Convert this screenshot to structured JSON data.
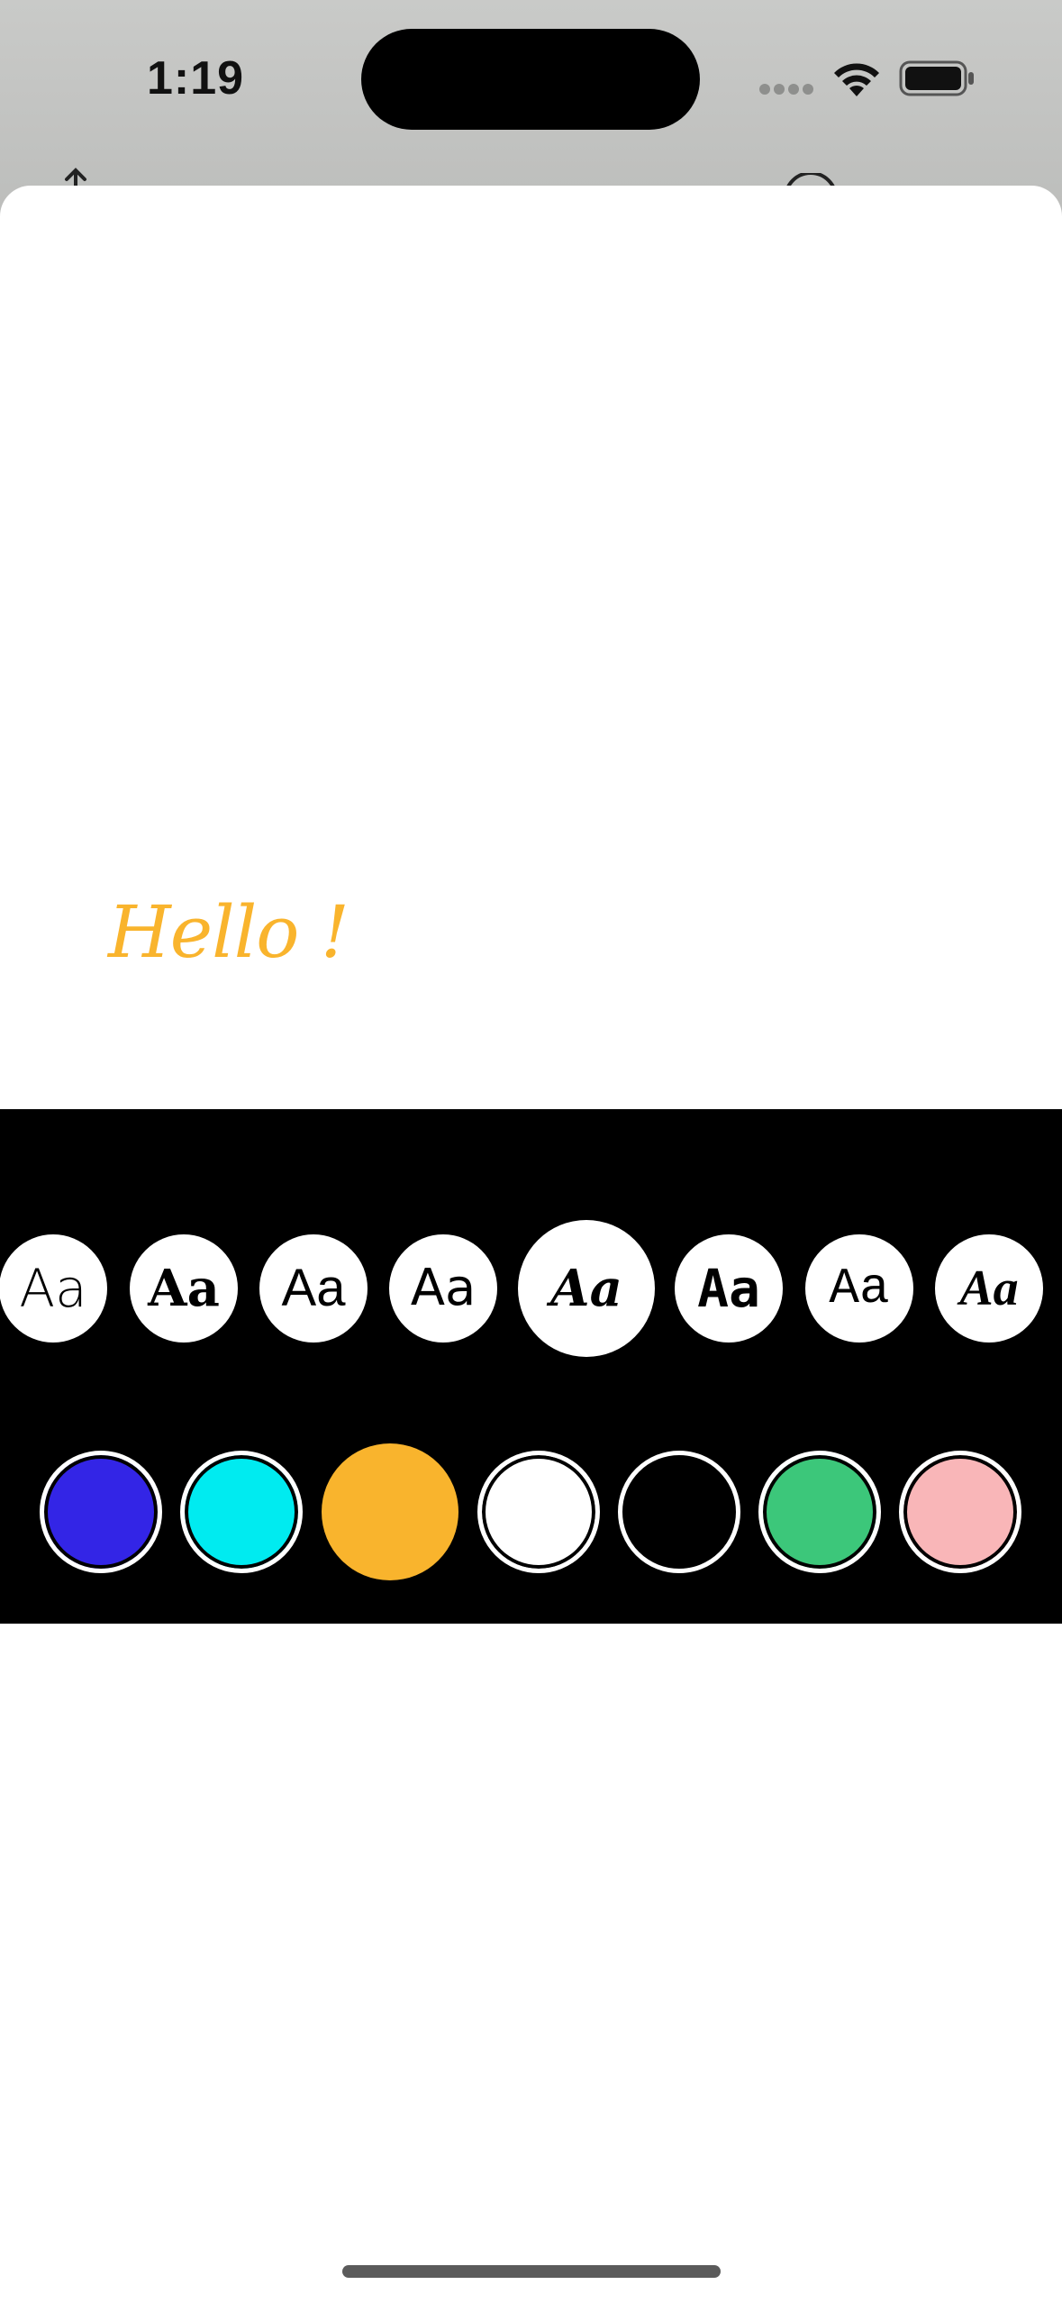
{
  "status_bar": {
    "time": "1:19"
  },
  "canvas": {
    "text": "Hello !",
    "text_color": "#f9b42d"
  },
  "font_options": [
    {
      "label": "Aa",
      "style": "thin-sans",
      "selected": false
    },
    {
      "label": "Aa",
      "style": "heavy-slab",
      "selected": false
    },
    {
      "label": "Aa",
      "style": "rounded-sans",
      "selected": false
    },
    {
      "label": "Aa",
      "style": "geometric-sans",
      "selected": false
    },
    {
      "label": "Aa",
      "style": "bold-italic-serif",
      "selected": true
    },
    {
      "label": "Aa",
      "style": "marker",
      "selected": false
    },
    {
      "label": "Aa",
      "style": "distressed",
      "selected": false
    },
    {
      "label": "Aa",
      "style": "italic-serif",
      "selected": false
    }
  ],
  "color_options": [
    {
      "name": "blue",
      "hex": "#3325e6",
      "selected": false
    },
    {
      "name": "cyan",
      "hex": "#00ebf0",
      "selected": false
    },
    {
      "name": "orange",
      "hex": "#f9b42d",
      "selected": true
    },
    {
      "name": "white",
      "hex": "#ffffff",
      "selected": false
    },
    {
      "name": "black",
      "hex": "#000000",
      "selected": false
    },
    {
      "name": "green",
      "hex": "#3cc77a",
      "selected": false
    },
    {
      "name": "pink",
      "hex": "#f9b6b8",
      "selected": false
    }
  ]
}
